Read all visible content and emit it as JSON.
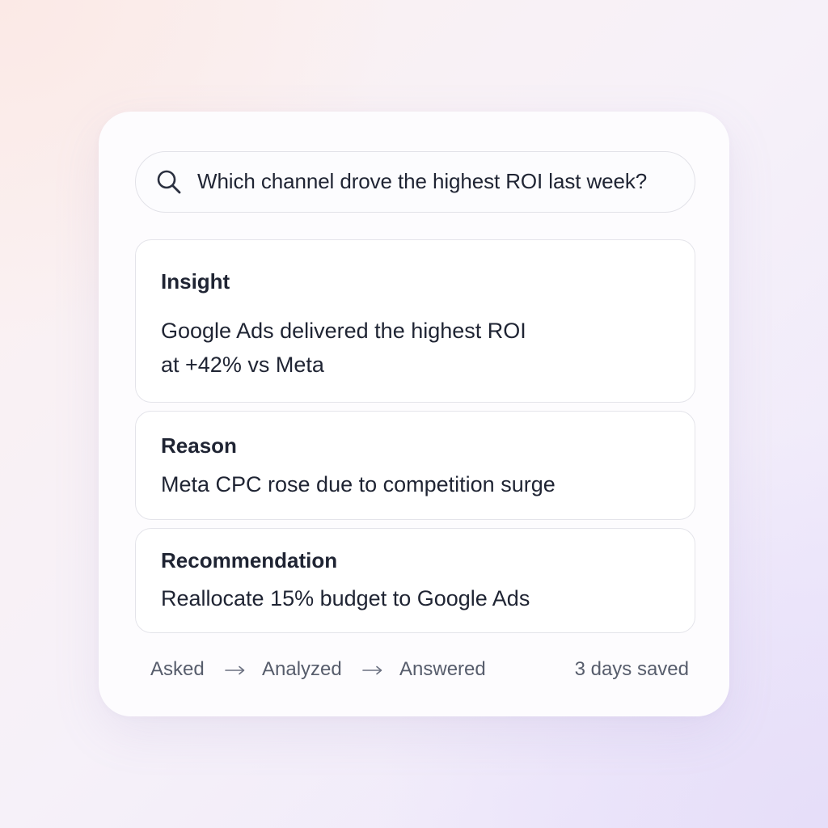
{
  "search": {
    "icon": "search-icon",
    "query": "Which channel drove the highest ROI last week?"
  },
  "insight": {
    "heading": "Insight",
    "body_lines": [
      "Google Ads delivered the highest ROI",
      "at +42% vs Meta"
    ]
  },
  "reason": {
    "heading": "Reason",
    "body": "Meta CPC rose due to competition surge"
  },
  "recommendation": {
    "heading": "Recommendation",
    "body": "Reallocate 15% budget to Google Ads"
  },
  "footer": {
    "steps": [
      "Asked",
      "Analyzed",
      "Answered"
    ],
    "arrow_icon": "arrow-right-icon",
    "time_saved": "3 days saved"
  },
  "colors": {
    "text_primary": "#1f2433",
    "text_secondary": "#575d6c",
    "border": "#e4e4ea"
  }
}
